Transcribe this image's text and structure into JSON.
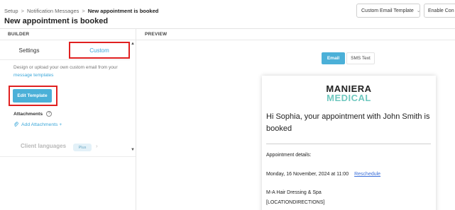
{
  "header": {
    "breadcrumb": [
      "Setup",
      "Notification Messages",
      "New appointment is booked"
    ],
    "breadcrumb_sep": ">",
    "title": "New appointment is booked",
    "template_select": "Custom Email Template",
    "enable_button": "Enable Con"
  },
  "builder": {
    "heading": "BUILDER",
    "tabs": [
      "Settings",
      "Custom"
    ],
    "description_text": "Design or upload your own custom email from your",
    "description_link": "message templates",
    "edit_button": "Edit Template",
    "attachments_label": "Attachments",
    "help_glyph": "?",
    "add_attachments": "Add Attachments +",
    "client_languages": "Client languages",
    "plus_badge": "Plus",
    "chevron": "›"
  },
  "preview": {
    "heading": "PREVIEW",
    "toggle": [
      "Email",
      "SMS Text"
    ],
    "logo": {
      "line1": "MANIERA",
      "line2": "MEDICAL",
      "accent_color": "#6fc8bf"
    },
    "greeting": "Hi Sophia, your appointment with John Smith is booked",
    "details_label": "Appointment details:",
    "datetime": "Monday, 16 November, 2024 at  11:00",
    "reschedule": "Reschedule",
    "business": "M-A Hair Dressing & Spa",
    "location": "[LOCATIONDIRECTIONS]"
  },
  "colors": {
    "accent": "#4bb0d8",
    "highlight_outline": "#e02020",
    "link": "#3ba7d9"
  },
  "icons": [
    "chevron-down-icon",
    "help-icon",
    "paperclip-icon",
    "scroll-up-icon",
    "scroll-down-icon",
    "chevron-right-icon"
  ]
}
